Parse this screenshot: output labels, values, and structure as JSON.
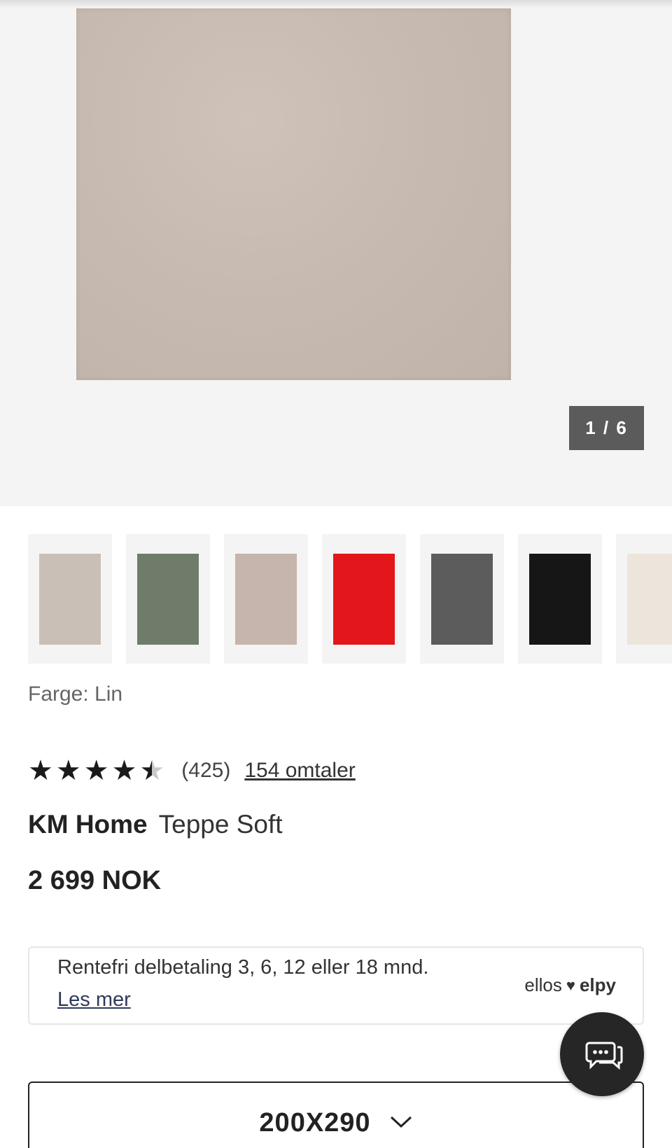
{
  "gallery": {
    "counter_text": "1 / 6",
    "main_image_color": "#c7bbb1"
  },
  "thumbnails": [
    {
      "color": "#c9bfb7"
    },
    {
      "color": "#6f7c69"
    },
    {
      "color": "#c6b5ac"
    },
    {
      "color": "#e3161c"
    },
    {
      "color": "#5c5c5c"
    },
    {
      "color": "#161616"
    },
    {
      "color": "#ede5dc"
    }
  ],
  "color": {
    "label": "Farge: Lin"
  },
  "rating": {
    "value": 4.5,
    "count": "(425)",
    "reviews_link": "154 omtaler"
  },
  "product": {
    "brand": "KM Home",
    "name": "Teppe Soft",
    "price": "2 699 NOK"
  },
  "financing": {
    "text": "Rentefri delbetaling 3, 6, 12 eller 18 mnd.",
    "link": "Les mer",
    "logo_left": "ellos",
    "logo_heart": "♥",
    "logo_right": "elpy"
  },
  "size_selector": {
    "value": "200X290"
  },
  "icons": {
    "chat": "chat-bubbles-icon",
    "chevron": "chevron-down-icon"
  }
}
